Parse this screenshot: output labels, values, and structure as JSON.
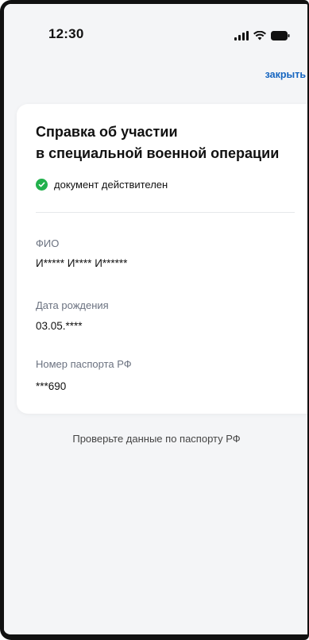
{
  "status_bar": {
    "time": "12:30",
    "icons": [
      "signal-icon",
      "wifi-icon",
      "battery-icon"
    ]
  },
  "header": {
    "close_label": "закрыть"
  },
  "card": {
    "title_line1": "Справка об участии",
    "title_line2": "в специальной военной операции",
    "status": "документ действителен",
    "fields": [
      {
        "label": "ФИО",
        "value": "И***** И**** И******"
      },
      {
        "label": "Дата рождения",
        "value": "03.05.****"
      },
      {
        "label": "Номер паспорта РФ",
        "value": "***690"
      }
    ]
  },
  "footer": {
    "hint": "Проверьте данные по паспорту РФ"
  },
  "colors": {
    "accent": "#1565c0",
    "success": "#22b14c",
    "background": "#f4f5f7",
    "card": "#ffffff"
  }
}
